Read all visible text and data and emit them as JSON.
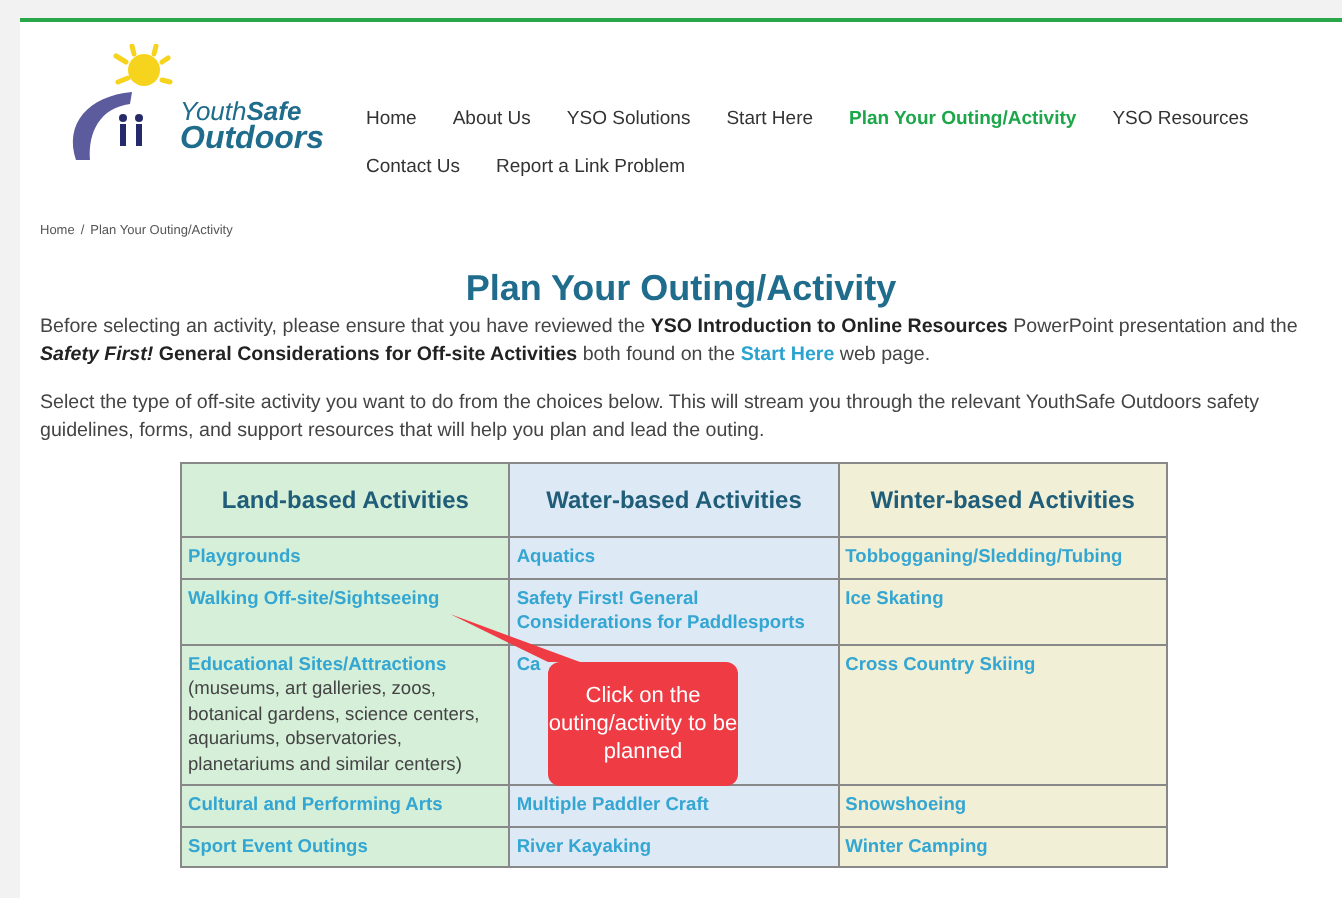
{
  "logo": {
    "line1": "Youth**Safe**",
    "line2": "Outdoors"
  },
  "nav": [
    {
      "label": "Home",
      "selected": false
    },
    {
      "label": "About Us",
      "selected": false
    },
    {
      "label": "YSO Solutions",
      "selected": false
    },
    {
      "label": "Start Here",
      "selected": false
    },
    {
      "label": "Plan Your Outing/Activity",
      "selected": true
    },
    {
      "label": "YSO Resources",
      "selected": false
    },
    {
      "label": "Contact Us",
      "selected": false
    },
    {
      "label": "Report a Link Problem",
      "selected": false
    }
  ],
  "breadcrumb": {
    "home": "Home",
    "separator": "/",
    "current": "Plan Your Outing/Activity"
  },
  "title": "Plan Your Outing/Activity",
  "intro": {
    "before": "Before selecting an activity, please ensure that you have reviewed the **YSO Introduction to Online Resources** PowerPoint presentation and the *Safety First!* **General Considerations for Off-site Activities** both found on the",
    "link": "Start Here",
    "after": "web page."
  },
  "instructions": "Select the type of off-site activity you want to do from the choices below. This will stream you through the relevant YouthSafe Outdoors safety guidelines, forms, and support resources that will help you plan and lead the outing.",
  "table": {
    "columns": [
      {
        "title": "Land-based Activities",
        "color": "#d5efd8"
      },
      {
        "title": "Water-based Activities",
        "color": "#dde9f5"
      },
      {
        "title": "Winter-based Activities",
        "color": "#f1efd6"
      }
    ],
    "rows": [
      [
        {
          "link": "Playgrounds"
        },
        {
          "link": "Aquatics"
        },
        {
          "link": "Tobbogganing/Sledding/Tubing"
        }
      ],
      [
        {
          "link": "Walking Off-site/Sightseeing"
        },
        {
          "link": "Safety First! General Considerations for Paddlesports"
        },
        {
          "link": "Ice Skating"
        }
      ],
      [
        {
          "link": "Educational Sites/Attractions",
          "note": "(museums, art galleries, zoos, botanical gardens, science centers, aquariums, observatories, planetariums and similar centers)"
        },
        {
          "link": "Ca"
        },
        {
          "link": "Cross Country Skiing"
        }
      ],
      [
        {
          "link": "Cultural and Performing Arts"
        },
        {
          "link": "Multiple Paddler Craft"
        },
        {
          "link": "Snowshoeing"
        }
      ],
      [
        {
          "link": "Sport Event Outings"
        },
        {
          "link": "River Kayaking"
        },
        {
          "link": "Winter Camping"
        }
      ]
    ]
  },
  "callout": "Click on the outing/activity to be planned"
}
